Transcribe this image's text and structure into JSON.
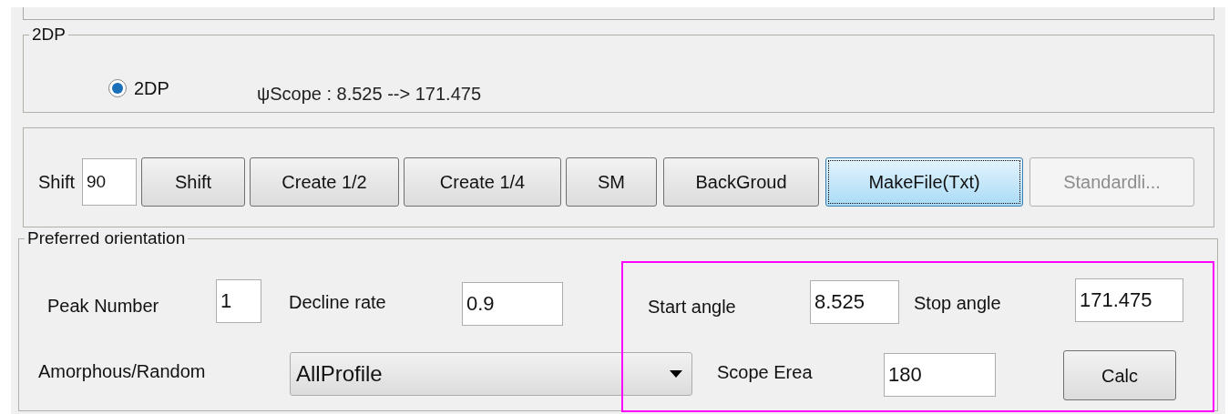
{
  "group_2dp": {
    "legend": "2DP",
    "radio": {
      "label": "2DP",
      "selected": true
    },
    "scope_text": "ψScope : 8.525 --> 171.475"
  },
  "toolbar": {
    "shift_label": "Shift",
    "shift_value": "90",
    "buttons": [
      {
        "label": "Shift",
        "focused": false,
        "disabled": false
      },
      {
        "label": "Create 1/2",
        "focused": false,
        "disabled": false
      },
      {
        "label": "Create 1/4",
        "focused": false,
        "disabled": false
      },
      {
        "label": "SM",
        "focused": false,
        "disabled": false
      },
      {
        "label": "BackGroud",
        "focused": false,
        "disabled": false
      },
      {
        "label": "MakeFile(Txt)",
        "focused": true,
        "disabled": false
      },
      {
        "label": "Standardli...",
        "focused": false,
        "disabled": true
      }
    ]
  },
  "preferred_orientation": {
    "legend": "Preferred orientation",
    "peak_number": {
      "label": "Peak Number",
      "value": "1"
    },
    "decline_rate": {
      "label": "Decline rate",
      "value": "0.9"
    },
    "start_angle": {
      "label": "Start angle",
      "value": "8.525"
    },
    "stop_angle": {
      "label": "Stop angle",
      "value": "171.475"
    },
    "amorphous": {
      "label": "Amorphous/Random",
      "value": "AllProfile"
    },
    "scope_erea": {
      "label": "Scope Erea",
      "value": "180"
    },
    "calc_button": {
      "label": "Calc"
    },
    "highlight": {
      "color": "#ff00ff"
    }
  }
}
